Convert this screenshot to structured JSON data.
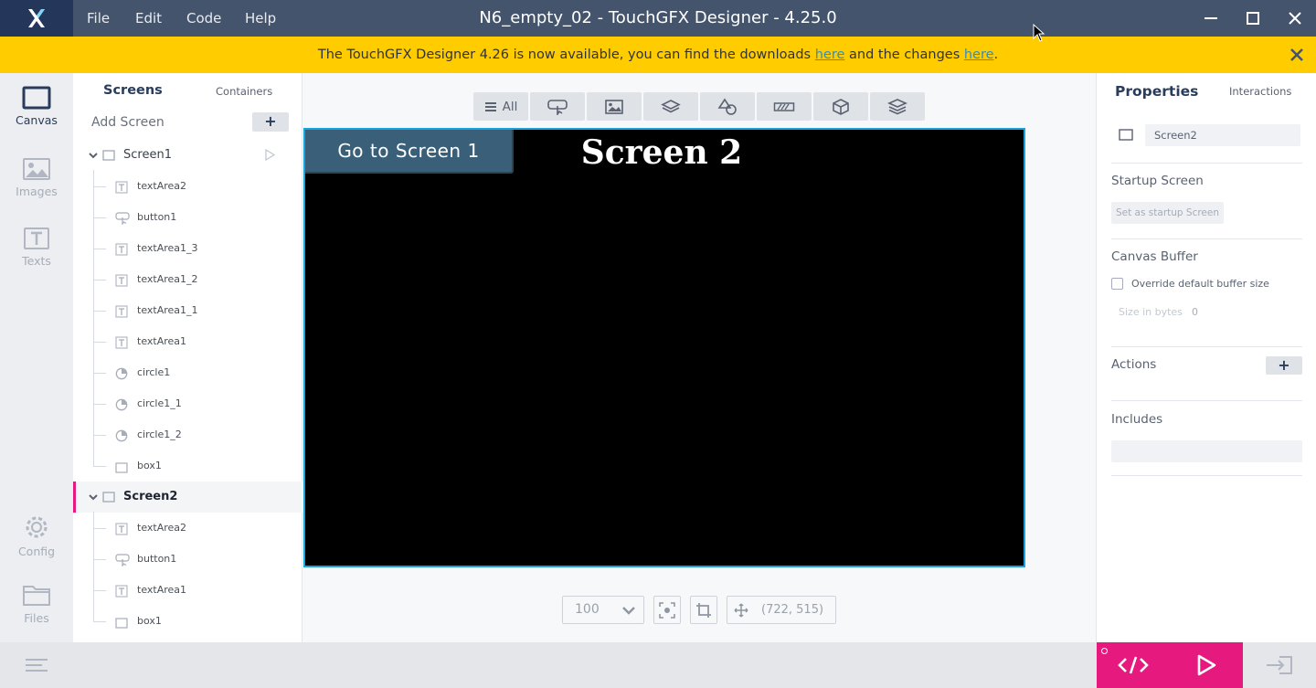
{
  "titlebar": {
    "logo": "touchgfx-logo-icon",
    "menu": [
      "File",
      "Edit",
      "Code",
      "Help"
    ],
    "title": "N6_empty_02 - TouchGFX Designer - 4.25.0"
  },
  "banner": {
    "text_before": "The TouchGFX Designer 4.26 is now available, you can find the downloads ",
    "link1": "here",
    "text_middle": " and the changes ",
    "link2": "here",
    "text_after": "."
  },
  "rail": {
    "items": [
      {
        "label": "Canvas",
        "icon": "canvas-icon"
      },
      {
        "label": "Images",
        "icon": "images-icon"
      },
      {
        "label": "Texts",
        "icon": "texts-icon"
      },
      {
        "label": "Config",
        "icon": "gear-icon"
      },
      {
        "label": "Files",
        "icon": "folder-icon"
      }
    ]
  },
  "tree": {
    "tab_screens": "Screens",
    "tab_containers": "Containers",
    "add_screen": "Add Screen",
    "add_button": "+",
    "screen1": {
      "name": "Screen1",
      "children": [
        {
          "name": "textArea2",
          "icon": "text-icon"
        },
        {
          "name": "button1",
          "icon": "button-icon"
        },
        {
          "name": "textArea1_3",
          "icon": "text-icon"
        },
        {
          "name": "textArea1_2",
          "icon": "text-icon"
        },
        {
          "name": "textArea1_1",
          "icon": "text-icon"
        },
        {
          "name": "textArea1",
          "icon": "text-icon"
        },
        {
          "name": "circle1",
          "icon": "circle-icon"
        },
        {
          "name": "circle1_1",
          "icon": "circle-icon"
        },
        {
          "name": "circle1_2",
          "icon": "circle-icon"
        },
        {
          "name": "box1",
          "icon": "box-icon"
        }
      ]
    },
    "screen2": {
      "name": "Screen2",
      "children": [
        {
          "name": "textArea2",
          "icon": "text-icon"
        },
        {
          "name": "button1",
          "icon": "button-icon"
        },
        {
          "name": "textArea1",
          "icon": "text-icon"
        },
        {
          "name": "box1",
          "icon": "box-icon"
        }
      ]
    }
  },
  "canvas": {
    "filter_all": "All",
    "screen_button": "Go to Screen 1",
    "screen_title": "Screen 2",
    "zoom": "100",
    "coords": "(722, 515)"
  },
  "props": {
    "tab_properties": "Properties",
    "tab_interactions": "Interactions",
    "name_value": "Screen2",
    "startup_title": "Startup Screen",
    "startup_button": "Set as startup Screen",
    "buffer_title": "Canvas Buffer",
    "override_label": "Override default buffer size",
    "size_label": "Size in bytes",
    "size_value": "0",
    "actions_title": "Actions",
    "actions_add": "+",
    "includes_title": "Includes"
  },
  "colors": {
    "titlebar": "#44546d",
    "banner": "#ffcc00",
    "accent_pink": "#e6197e",
    "screen_border": "#1aa3df",
    "selected_marker": "#e6197e"
  }
}
